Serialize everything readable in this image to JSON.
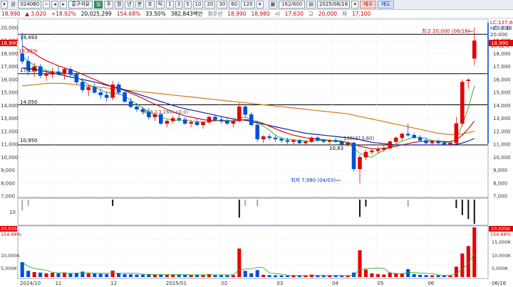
{
  "toolbar": {
    "mode_label": "권",
    "code": "024060",
    "stock_name": "흥구석유",
    "period_buttons": [
      "주",
      "월",
      "년",
      "분",
      "초",
      "틱"
    ],
    "interval_buttons": [
      "1",
      "3",
      "5",
      "10",
      "20",
      "30",
      "60",
      "120"
    ],
    "counter": "162/600",
    "date": "2025/06/16",
    "buy_label": "매수",
    "sell_label": "매도"
  },
  "quote": {
    "price": "18,990",
    "change": "▲ 3,020",
    "change_pct": "+18.92%",
    "volume": "20,025,299",
    "vol_ratio": "154.68%",
    "turnover": "33.50%",
    "amount": "382,843백만",
    "preferred_label": "최우선",
    "ask": "18,990",
    "bid": "18,980",
    "open_label": "시",
    "open": "17,630",
    "high_label": "고",
    "high": "20,000",
    "low_label": "저",
    "low": "17,100"
  },
  "colors": {
    "up": "#e60000",
    "down": "#0050d8",
    "ma5": "#22aa22",
    "ma20": "#cc0000",
    "ma60": "#1a1a9a",
    "ma120": "#d47a1a",
    "hline": "#000000",
    "grid": "#c8d0da",
    "volume_up": "#e60000",
    "volume_down": "#0050d8"
  },
  "price_axis": {
    "ticks": [
      "20,000",
      "19,000",
      "18,000",
      "17,000",
      "16,000",
      "15,000",
      "14,000",
      "13,000",
      "12,000",
      "11,000",
      "10,000",
      "9,000",
      "8,000",
      "7,000"
    ],
    "right_indicators": [
      "LC:137.84",
      "HC:-5.10",
      "20.000",
      "18.92%"
    ],
    "current_tag": "18,990"
  },
  "left_axis": {
    "current_tag": "18,990",
    "change_pct": "18.92%",
    "bottom_tick": "10"
  },
  "annotations": {
    "high_label": "최고 20,000 (06/16)",
    "low_label": "최저 7,980 (04/03)",
    "ma_label": "MA5 13,260(+0.0)",
    "ma_label2": "136(313,80)",
    "level_19493": "19,493",
    "level_17190": "17,190",
    "level_14050": "14,050",
    "level_10950": "10,950",
    "level_10830": "10,83"
  },
  "volume_axis": {
    "left_tags": [
      "20,025K",
      "154.68%"
    ],
    "right_tags": [
      "20,025K",
      "154.68%"
    ],
    "ticks": [
      "15,000K",
      "10,000K",
      "5,000K"
    ]
  },
  "date_axis": {
    "labels": [
      "2024/10",
      "11",
      "12",
      "2025/01",
      "02",
      "03",
      "04",
      "05",
      "06",
      "06/16"
    ]
  },
  "chart_data": {
    "type": "candlestick",
    "title": "",
    "x_range": [
      "2024/10",
      "2025/06/16"
    ],
    "ylim": [
      7000,
      20000
    ],
    "horizontal_levels": [
      19493,
      16450,
      14050,
      10950
    ],
    "ohlc": [
      [
        18000,
        19600,
        17200,
        17400
      ],
      [
        17400,
        17800,
        16300,
        16700
      ],
      [
        16700,
        17300,
        16200,
        17000
      ],
      [
        17000,
        17200,
        16100,
        16300
      ],
      [
        16300,
        16700,
        15900,
        16400
      ],
      [
        16400,
        16900,
        16100,
        16600
      ],
      [
        16600,
        17000,
        16300,
        16500
      ],
      [
        16500,
        16900,
        16000,
        16800
      ],
      [
        16800,
        17000,
        16200,
        16400
      ],
      [
        16400,
        16600,
        15600,
        15800
      ],
      [
        15800,
        16100,
        15000,
        15200
      ],
      [
        15200,
        15600,
        14700,
        15400
      ],
      [
        15400,
        15700,
        14900,
        15000
      ],
      [
        15000,
        15300,
        14500,
        14800
      ],
      [
        14800,
        15100,
        14300,
        14600
      ],
      [
        14600,
        15900,
        14400,
        15600
      ],
      [
        15600,
        15800,
        14800,
        15000
      ],
      [
        15000,
        15200,
        14200,
        14300
      ],
      [
        14300,
        14600,
        13800,
        13900
      ],
      [
        13900,
        14200,
        13500,
        13700
      ],
      [
        13700,
        13900,
        13300,
        13500
      ],
      [
        13500,
        13800,
        12900,
        13100
      ],
      [
        13100,
        13500,
        12800,
        13300
      ],
      [
        13300,
        13400,
        12500,
        12600
      ],
      [
        12600,
        12900,
        12300,
        12800
      ],
      [
        12800,
        13200,
        12600,
        13000
      ],
      [
        13000,
        13400,
        12700,
        12900
      ],
      [
        12900,
        13100,
        12500,
        12600
      ],
      [
        12600,
        12900,
        12300,
        12700
      ],
      [
        12700,
        13000,
        12400,
        12500
      ],
      [
        12500,
        12800,
        12200,
        12700
      ],
      [
        12700,
        13200,
        12600,
        13100
      ],
      [
        13100,
        13300,
        12800,
        12900
      ],
      [
        12900,
        13100,
        12600,
        12800
      ],
      [
        12800,
        13000,
        12500,
        12600
      ],
      [
        12600,
        12900,
        12300,
        12800
      ],
      [
        12800,
        14200,
        12700,
        13900
      ],
      [
        13900,
        14000,
        13100,
        13300
      ],
      [
        13300,
        13500,
        12400,
        12500
      ],
      [
        12500,
        12800,
        11200,
        11400
      ],
      [
        11400,
        11700,
        11100,
        11600
      ],
      [
        11600,
        11800,
        11300,
        11500
      ],
      [
        11500,
        11700,
        11200,
        11400
      ],
      [
        11400,
        11600,
        11100,
        11300
      ],
      [
        11300,
        11500,
        11000,
        11200
      ],
      [
        11200,
        11400,
        11000,
        11300
      ],
      [
        11300,
        11400,
        11000,
        11100
      ],
      [
        11100,
        11300,
        10900,
        11200
      ],
      [
        11200,
        11600,
        11100,
        11500
      ],
      [
        11500,
        11600,
        11200,
        11300
      ],
      [
        11300,
        11400,
        11100,
        11200
      ],
      [
        11200,
        11400,
        11000,
        11300
      ],
      [
        11300,
        11500,
        11100,
        11200
      ],
      [
        11200,
        11300,
        10900,
        11000
      ],
      [
        11000,
        11200,
        10800,
        11100
      ],
      [
        11100,
        11200,
        8900,
        9100
      ],
      [
        9100,
        10200,
        7980,
        10000
      ],
      [
        10000,
        10600,
        9800,
        10400
      ],
      [
        10400,
        10700,
        10200,
        10500
      ],
      [
        10500,
        10800,
        10300,
        10600
      ],
      [
        10600,
        10900,
        10400,
        10700
      ],
      [
        10700,
        11300,
        10600,
        11200
      ],
      [
        11200,
        11600,
        11000,
        11500
      ],
      [
        11500,
        11900,
        11300,
        11800
      ],
      [
        11800,
        12600,
        11600,
        11700
      ],
      [
        11700,
        11900,
        11400,
        11500
      ],
      [
        11500,
        11700,
        11200,
        11300
      ],
      [
        11300,
        11500,
        11000,
        11100
      ],
      [
        11100,
        11300,
        10900,
        11200
      ],
      [
        11200,
        11400,
        11000,
        11100
      ],
      [
        11100,
        11300,
        10900,
        11000
      ],
      [
        11000,
        11200,
        10900,
        11100
      ],
      [
        11100,
        13100,
        11000,
        12600
      ],
      [
        12600,
        16000,
        12400,
        15800
      ],
      [
        15900,
        16100,
        15300,
        15970
      ],
      [
        17630,
        20000,
        17100,
        18990
      ]
    ],
    "ma5": [
      17800,
      17400,
      17100,
      16900,
      16700,
      16600,
      16550,
      16500,
      16400,
      16200,
      15900,
      15600,
      15400,
      15200,
      15000,
      14950,
      14900,
      14700,
      14400,
      14100,
      13800,
      13500,
      13300,
      13100,
      12950,
      12850,
      12850,
      12850,
      12800,
      12750,
      12700,
      12750,
      12800,
      12850,
      12850,
      12800,
      13000,
      13100,
      12900,
      12700,
      12400,
      12100,
      11700,
      11450,
      11400,
      11350,
      11300,
      11250,
      11250,
      11300,
      11300,
      11300,
      11300,
      11250,
      11150,
      10700,
      10300,
      10100,
      10000,
      10300,
      10550,
      10750,
      11000,
      11250,
      11400,
      11550,
      11550,
      11450,
      11300,
      11200,
      11150,
      11100,
      11450,
      12500,
      13800,
      15500
    ],
    "ma20": [
      18600,
      18300,
      18000,
      17700,
      17450,
      17250,
      17050,
      16900,
      16750,
      16600,
      16400,
      16200,
      16000,
      15800,
      15600,
      15450,
      15300,
      15150,
      14950,
      14750,
      14550,
      14300,
      14100,
      13900,
      13700,
      13500,
      13350,
      13200,
      13100,
      13000,
      12900,
      12850,
      12850,
      12800,
      12800,
      12800,
      12850,
      12900,
      12850,
      12750,
      12600,
      12400,
      12200,
      12000,
      11850,
      11700,
      11600,
      11500,
      11450,
      11400,
      11350,
      11300,
      11250,
      11200,
      11150,
      11000,
      10850,
      10750,
      10650,
      10650,
      10700,
      10750,
      10850,
      10950,
      11050,
      11150,
      11200,
      11250,
      11250,
      11250,
      11200,
      11200,
      11350,
      11700,
      12200,
      12800
    ],
    "ma60": [
      16900,
      16850,
      16800,
      16700,
      16600,
      16500,
      16400,
      16300,
      16200,
      16100,
      16000,
      15900,
      15800,
      15700,
      15550,
      15450,
      15350,
      15200,
      15050,
      14900,
      14750,
      14600,
      14450,
      14300,
      14150,
      14000,
      13850,
      13750,
      13650,
      13550,
      13450,
      13350,
      13250,
      13150,
      13050,
      12950,
      12900,
      12850,
      12750,
      12650,
      12550,
      12450,
      12350,
      12250,
      12150,
      12050,
      11950,
      11850,
      11800,
      11750,
      11700,
      11650,
      11600,
      11550,
      11500,
      11450,
      11350,
      11250,
      11150,
      11100,
      11050,
      11000,
      10950,
      10950,
      10950,
      10950,
      10950,
      10950,
      10950,
      10950,
      10950,
      10950,
      11000,
      11100,
      11250,
      11450
    ],
    "ma120": [
      15500,
      15550,
      15600,
      15650,
      15700,
      15700,
      15700,
      15700,
      15650,
      15600,
      15550,
      15500,
      15450,
      15400,
      15350,
      15300,
      15250,
      15200,
      15150,
      15100,
      15050,
      15000,
      14950,
      14900,
      14850,
      14800,
      14750,
      14700,
      14650,
      14600,
      14550,
      14500,
      14450,
      14400,
      14350,
      14300,
      14250,
      14200,
      14150,
      14100,
      14050,
      14000,
      13950,
      13900,
      13850,
      13800,
      13750,
      13700,
      13650,
      13600,
      13550,
      13500,
      13450,
      13400,
      13350,
      13250,
      13150,
      13050,
      12950,
      12850,
      12750,
      12650,
      12550,
      12450,
      12350,
      12250,
      12150,
      12050,
      11950,
      11850,
      11800,
      11750,
      11750,
      11800,
      11900,
      12000
    ],
    "volume_k": [
      6000,
      2500,
      2000,
      1800,
      1500,
      1700,
      1500,
      1800,
      1400,
      1600,
      2200,
      1500,
      1400,
      1300,
      1200,
      2600,
      1500,
      1200,
      1100,
      1000,
      1000,
      1100,
      900,
      1000,
      900,
      1000,
      900,
      900,
      800,
      900,
      800,
      1200,
      800,
      800,
      700,
      800,
      11500,
      2500,
      1500,
      2800,
      900,
      800,
      700,
      700,
      600,
      600,
      600,
      600,
      1000,
      700,
      600,
      600,
      600,
      600,
      600,
      1800,
      10800,
      3000,
      1500,
      1200,
      1000,
      1800,
      1500,
      1400,
      3200,
      1200,
      900,
      800,
      700,
      700,
      600,
      600,
      4200,
      9500,
      12500,
      20025
    ]
  }
}
